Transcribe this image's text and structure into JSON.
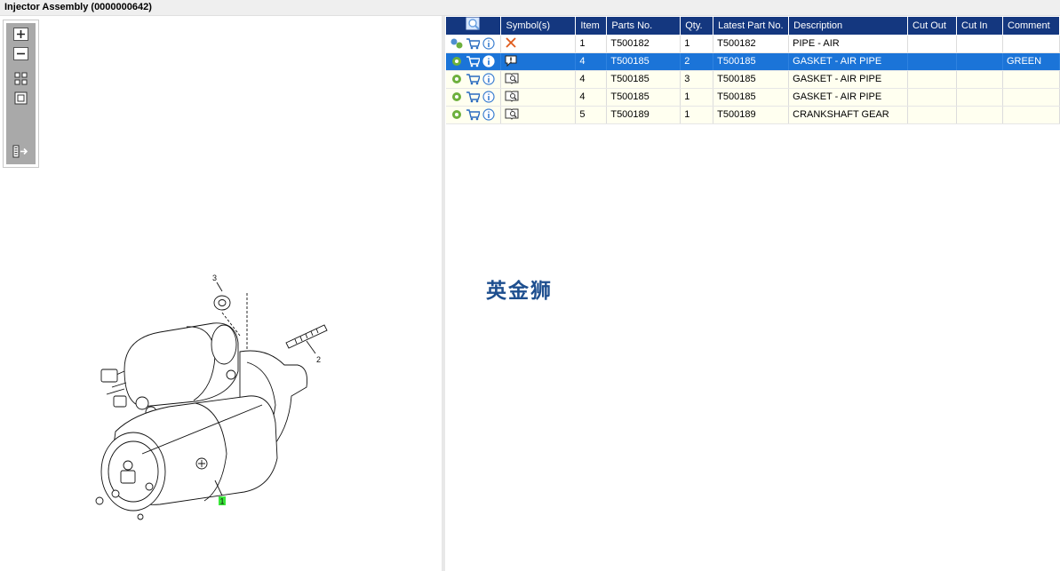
{
  "window": {
    "title": "Injector Assembly (0000000642)"
  },
  "viewer": {
    "toolbar": [
      "zoom-in",
      "zoom-out",
      "fit-all",
      "fit-window",
      "export"
    ],
    "callouts": [
      {
        "label": "3"
      },
      {
        "label": "2"
      },
      {
        "label": "1",
        "highlight": "#39e639"
      }
    ]
  },
  "table": {
    "columns": [
      "",
      "Symbol(s)",
      "Item",
      "Parts No.",
      "Qty.",
      "Latest Part No.",
      "Description",
      "Cut Out",
      "Cut In",
      "Comment"
    ],
    "rows": [
      {
        "state": "white",
        "symbol": "cross-icon",
        "item": "1",
        "part_no": "T500182",
        "qty": "1",
        "latest": "T500182",
        "desc": "PIPE - AIR",
        "cut_out": "",
        "cut_in": "",
        "comment": ""
      },
      {
        "state": "selected",
        "symbol": "info-bubble-icon",
        "item": "4",
        "part_no": "T500185",
        "qty": "2",
        "latest": "T500185",
        "desc": "GASKET - AIR PIPE",
        "cut_out": "",
        "cut_in": "",
        "comment": "GREEN"
      },
      {
        "state": "yellow",
        "symbol": "book-search-icon",
        "item": "4",
        "part_no": "T500185",
        "qty": "3",
        "latest": "T500185",
        "desc": "GASKET - AIR PIPE",
        "cut_out": "",
        "cut_in": "",
        "comment": ""
      },
      {
        "state": "yellow",
        "symbol": "book-search-icon",
        "item": "4",
        "part_no": "T500185",
        "qty": "1",
        "latest": "T500185",
        "desc": "GASKET - AIR PIPE",
        "cut_out": "",
        "cut_in": "",
        "comment": ""
      },
      {
        "state": "yellow",
        "symbol": "book-search-icon",
        "item": "5",
        "part_no": "T500189",
        "qty": "1",
        "latest": "T500189",
        "desc": "CRANKSHAFT GEAR",
        "cut_out": "",
        "cut_in": "",
        "comment": ""
      }
    ]
  },
  "watermark": "英金狮",
  "colors": {
    "header": "#14377f",
    "selected": "#1b74d8",
    "row_alt": "#fffff0",
    "callout_highlight": "#39e639"
  }
}
